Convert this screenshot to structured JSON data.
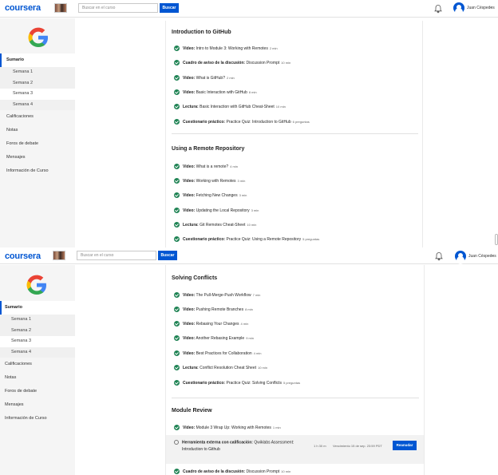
{
  "header": {
    "logo": "coursera",
    "search_placeholder": "Buscar en el curso",
    "search_button": "Buscar",
    "user_name": "Juan Céspedes",
    "bell_icon": "bell-icon",
    "avatar_icon": "user-avatar-icon"
  },
  "sidebar": {
    "logo_icon": "google-logo-icon",
    "summary": "Sumario",
    "weeks": [
      "Semana 1",
      "Semana 2",
      "Semana 3",
      "Semana 4"
    ],
    "items": [
      "Calificaciones",
      "Notas",
      "Foros de debate",
      "Mensajes",
      "Información de Curso"
    ]
  },
  "top": {
    "section1": {
      "title": "Introduction to GitHub",
      "items": [
        {
          "type": "Video:",
          "name": "Intro to Module 3: Working with Remotes",
          "dur": "2 min"
        },
        {
          "type": "Cuadro de aviso de la discusión:",
          "name": "Discussion Prompt",
          "dur": "10 min"
        },
        {
          "type": "Video:",
          "name": "What is GitHub?",
          "dur": "2 min"
        },
        {
          "type": "Video:",
          "name": "Basic Interaction with GitHub",
          "dur": "8 min"
        },
        {
          "type": "Lectura:",
          "name": "Basic Interaction with GitHub Cheat-Sheet",
          "dur": "10 min"
        },
        {
          "type": "Cuestionario práctico:",
          "name": "Practice Quiz: Introduction to GitHub",
          "dur": "6 preguntas"
        }
      ]
    },
    "section2": {
      "title": "Using a Remote Repository",
      "items": [
        {
          "type": "Video:",
          "name": "What is a remote?",
          "dur": "4 min"
        },
        {
          "type": "Video:",
          "name": "Working with Remotes",
          "dur": "3 min"
        },
        {
          "type": "Video:",
          "name": "Fetching New Changes",
          "dur": "3 min"
        },
        {
          "type": "Video:",
          "name": "Updating the Local Repository",
          "dur": "3 min"
        },
        {
          "type": "Lectura:",
          "name": "Git Remotes Cheat-Sheet",
          "dur": "10 min"
        },
        {
          "type": "Cuestionario práctico:",
          "name": "Practice Quiz: Using a Remote Repository",
          "dur": "5 preguntas"
        }
      ]
    }
  },
  "bottom": {
    "section3": {
      "title": "Solving Conflicts",
      "items": [
        {
          "type": "Video:",
          "name": "The Pull-Merge-Push Workflow",
          "dur": "7 min"
        },
        {
          "type": "Video:",
          "name": "Pushing Remote Branches",
          "dur": "8 min"
        },
        {
          "type": "Video:",
          "name": "Rebasing Your Changes",
          "dur": "4 min"
        },
        {
          "type": "Video:",
          "name": "Another Rebasing Example",
          "dur": "9 min"
        },
        {
          "type": "Video:",
          "name": "Best Practices for Collaboration",
          "dur": "4 min"
        },
        {
          "type": "Lectura:",
          "name": "Conflict Resolution Cheat Sheet",
          "dur": "10 min"
        },
        {
          "type": "Cuestionario práctico:",
          "name": "Practice Quiz: Solving Conflicts",
          "dur": "5 preguntas"
        }
      ]
    },
    "section4": {
      "title": "Module Review",
      "video": {
        "type": "Video:",
        "name": "Module 3 Wrap Up: Working with Remotes",
        "dur": "1 min"
      },
      "ext": {
        "type": "Herramienta externa con calificación:",
        "name_line1": "Qwiklabs Assessment:",
        "name_line2": "Introduction to Github",
        "dur": "1 h 30 m",
        "due": "Vencimiento 15 de sep. 23:59 PDT",
        "button": "Reanudar"
      },
      "disc": {
        "type": "Cuadro de aviso de la discusión:",
        "name": "Discussion Prompt",
        "dur": "10 min"
      }
    }
  },
  "colors": {
    "accent": "#0056d2",
    "complete": "#1f8354",
    "sidebar_bg": "#f5f5f5"
  }
}
